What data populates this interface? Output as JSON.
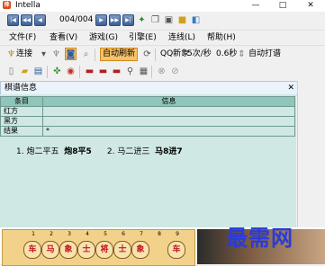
{
  "window": {
    "title": "Intella",
    "icon": "intella-app-icon",
    "minimize": "—",
    "maximize": "□",
    "close": "✕"
  },
  "toolbar1": {
    "counter": "004/004"
  },
  "menu": [
    "文件(F)",
    "查看(V)",
    "游戏(G)",
    "引擎(E)",
    "连线(L)",
    "帮助(H)"
  ],
  "toolbar2": {
    "connect": "连接",
    "auto_refresh": "自动刷新",
    "qq_label": "QQ新象",
    "speed": "5次/秒",
    "interval": "0.6秒",
    "auto_play": "自动打谱"
  },
  "panel": {
    "title": "棋谱信息",
    "close": "✕"
  },
  "table": {
    "headers": [
      "条目",
      "信息"
    ],
    "rows": [
      {
        "key": "红方",
        "value": ""
      },
      {
        "key": "黑方",
        "value": ""
      },
      {
        "key": "结果",
        "value": "*"
      }
    ]
  },
  "moves": [
    {
      "num": "1.",
      "red": "炮二平五",
      "black": "炮8平5"
    },
    {
      "num": "2.",
      "red": "马二进三",
      "black": "马8进7"
    }
  ],
  "board": {
    "file_numbers": [
      "1",
      "2",
      "3",
      "4",
      "5",
      "6",
      "7",
      "8",
      "9"
    ],
    "pieces": [
      "车",
      "马",
      "象",
      "士",
      "将",
      "士",
      "象",
      "",
      "车"
    ]
  },
  "watermark": "最需网"
}
